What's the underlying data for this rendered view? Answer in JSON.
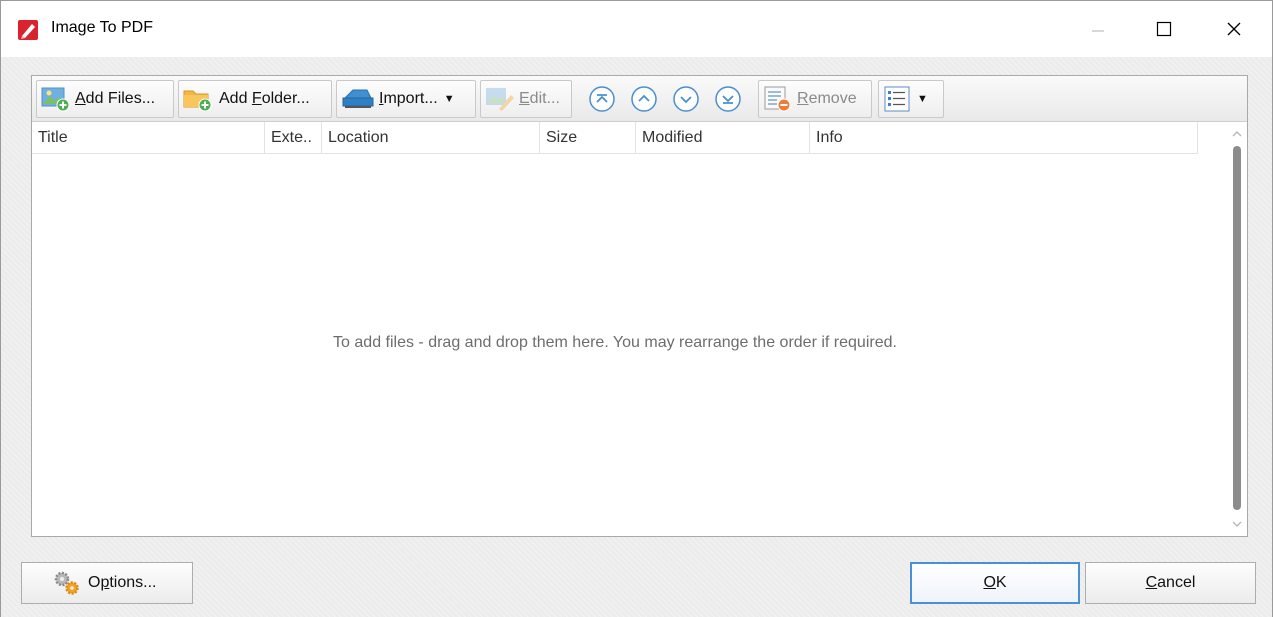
{
  "window": {
    "title": "Image To PDF"
  },
  "toolbar": {
    "add_files": {
      "prefix": "",
      "mnemonic": "A",
      "rest": "dd Files..."
    },
    "add_folder": {
      "prefix": "Add ",
      "mnemonic": "F",
      "rest": "older..."
    },
    "import": {
      "prefix": "",
      "mnemonic": "I",
      "rest": "mport..."
    },
    "edit": {
      "prefix": "",
      "mnemonic": "E",
      "rest": "dit..."
    },
    "remove": {
      "prefix": "",
      "mnemonic": "R",
      "rest": "emove"
    }
  },
  "columns": [
    "Title",
    "Exte..",
    "Location",
    "Size",
    "Modified",
    "Info"
  ],
  "empty_message": "To add files - drag and drop them here. You may rearrange the order if required.",
  "buttons": {
    "options": {
      "prefix": "O",
      "mnemonic": "p",
      "rest": "tions..."
    },
    "ok": {
      "mnemonic": "O",
      "rest": "K"
    },
    "cancel": {
      "mnemonic": "C",
      "rest": "ancel"
    }
  },
  "icons": {
    "app": "pdf-app-icon",
    "add_files": "image-add-icon",
    "add_folder": "folder-add-icon",
    "import": "scanner-icon",
    "edit": "image-edit-icon",
    "move_top": "move-to-top-icon",
    "move_up": "move-up-icon",
    "move_down": "move-down-icon",
    "move_bottom": "move-to-bottom-icon",
    "remove": "remove-icon",
    "view": "list-view-icon",
    "options": "gears-icon"
  },
  "colors": {
    "default_button_border": "#4a90d9",
    "app_icon_red": "#d9232d",
    "add_green": "#4caf50",
    "remove_orange": "#f07a3a"
  }
}
